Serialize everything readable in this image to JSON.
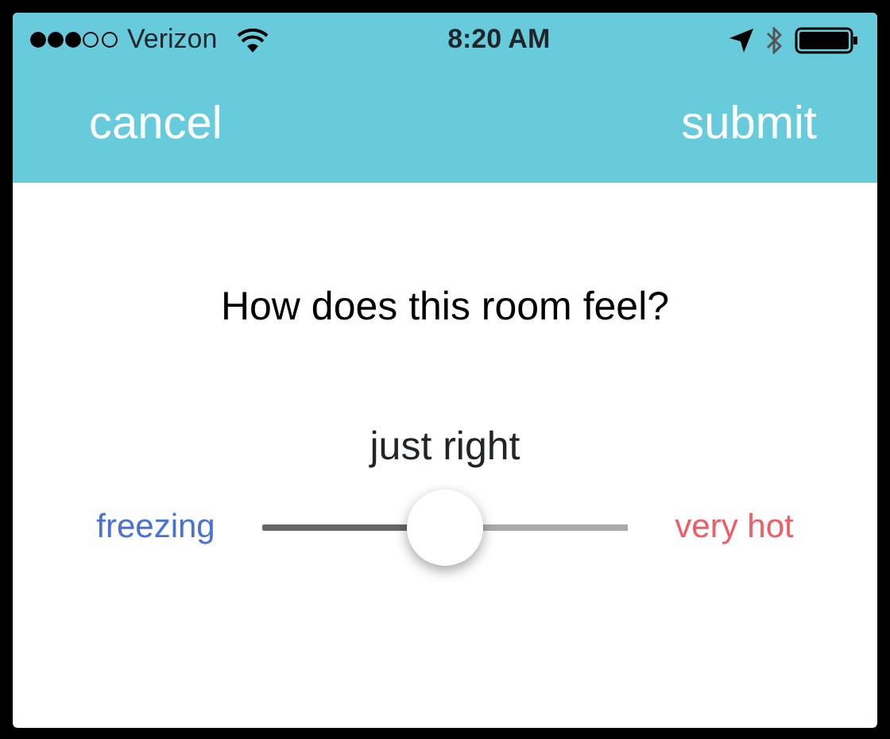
{
  "status_bar": {
    "carrier": "Verizon",
    "time": "8:20 AM"
  },
  "nav_bar": {
    "left_button": "cancel",
    "right_button": "submit"
  },
  "question": "How does this room feel?",
  "slider": {
    "reading": "just right",
    "min_label": "freezing",
    "max_label": "very hot",
    "level": 0.5
  }
}
